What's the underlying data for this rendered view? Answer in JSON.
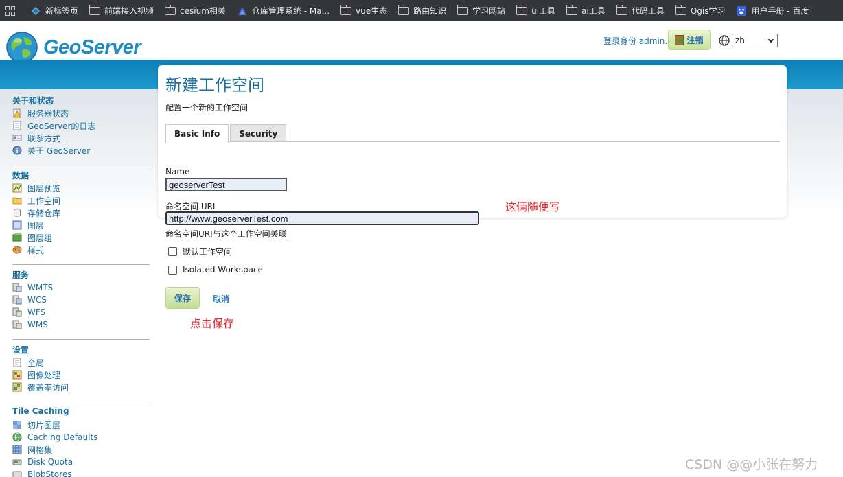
{
  "bookmarks": [
    {
      "label": "新标签页",
      "icon": "new-tab-icon"
    },
    {
      "label": "前端接入视频",
      "icon": "folder-icon"
    },
    {
      "label": "cesium相关",
      "icon": "folder-icon"
    },
    {
      "label": "仓库管理系统 - Ma...",
      "icon": "mantine-logo-icon"
    },
    {
      "label": "vue生态",
      "icon": "folder-icon"
    },
    {
      "label": "路由知识",
      "icon": "folder-icon"
    },
    {
      "label": "学习网站",
      "icon": "folder-icon"
    },
    {
      "label": "ui工具",
      "icon": "folder-icon"
    },
    {
      "label": "ai工具",
      "icon": "folder-icon"
    },
    {
      "label": "代码工具",
      "icon": "folder-icon"
    },
    {
      "label": "Qgis学习",
      "icon": "folder-icon"
    },
    {
      "label": "用户手册 - 百度",
      "icon": "baidu-icon"
    }
  ],
  "header": {
    "logo_text": "GeoServer",
    "login_text": "登录身份 admin.",
    "logout_label": "注销",
    "language": "zh"
  },
  "sidebar": {
    "sections": [
      {
        "title": "关于和状态",
        "items": [
          {
            "label": "服务器状态",
            "icon": "server-status-icon"
          },
          {
            "label": "GeoServer的日志",
            "icon": "log-file-icon"
          },
          {
            "label": "联系方式",
            "icon": "contact-card-icon"
          },
          {
            "label": "关于 GeoServer",
            "icon": "info-icon"
          }
        ]
      },
      {
        "title": "数据",
        "items": [
          {
            "label": "图层预览",
            "icon": "layer-preview-icon"
          },
          {
            "label": "工作空间",
            "icon": "workspace-folder-icon"
          },
          {
            "label": "存储仓库",
            "icon": "store-cylinder-icon"
          },
          {
            "label": "图层",
            "icon": "layer-icon"
          },
          {
            "label": "图层组",
            "icon": "layer-group-icon"
          },
          {
            "label": "样式",
            "icon": "style-palette-icon"
          }
        ]
      },
      {
        "title": "服务",
        "items": [
          {
            "label": "WMTS",
            "icon": "wmts-service-icon"
          },
          {
            "label": "WCS",
            "icon": "wcs-service-icon"
          },
          {
            "label": "WFS",
            "icon": "wfs-service-icon"
          },
          {
            "label": "WMS",
            "icon": "wms-service-icon"
          }
        ]
      },
      {
        "title": "设置",
        "items": [
          {
            "label": "全局",
            "icon": "global-settings-icon"
          },
          {
            "label": "图像处理",
            "icon": "image-processing-icon"
          },
          {
            "label": "覆盖率访问",
            "icon": "coverage-access-icon"
          }
        ]
      },
      {
        "title": "Tile Caching",
        "items": [
          {
            "label": "切片图层",
            "icon": "tile-layers-icon"
          },
          {
            "label": "Caching Defaults",
            "icon": "caching-defaults-icon"
          },
          {
            "label": "网格集",
            "icon": "gridset-icon"
          },
          {
            "label": "Disk Quota",
            "icon": "disk-quota-icon"
          },
          {
            "label": "BlobStores",
            "icon": "blobstore-icon"
          }
        ]
      }
    ]
  },
  "main": {
    "title": "新建工作空间",
    "description": "配置一个新的工作空间",
    "tabs": [
      {
        "label": "Basic Info",
        "active": true
      },
      {
        "label": "Security",
        "active": false
      }
    ],
    "name_label": "Name",
    "name_value": "geoserverTest",
    "uri_label": "命名空间 URI",
    "uri_value": "http://www.geoserverTest.com",
    "uri_help": "命名空间URI与这个工作空间关联",
    "default_workspace_label": "默认工作空间",
    "default_workspace_checked": false,
    "isolated_label": "Isolated Workspace",
    "isolated_checked": false,
    "save_label": "保存",
    "cancel_label": "取消"
  },
  "annotations": {
    "fill_note": "这俩随便写",
    "save_note": "点击保存"
  },
  "watermark": "CSDN @@小张在努力",
  "colors": {
    "link_blue": "#1a6f9e",
    "band_blue": "#0f7fb8",
    "annotation_red": "#e8292f",
    "button_green": "#c3dd92"
  }
}
